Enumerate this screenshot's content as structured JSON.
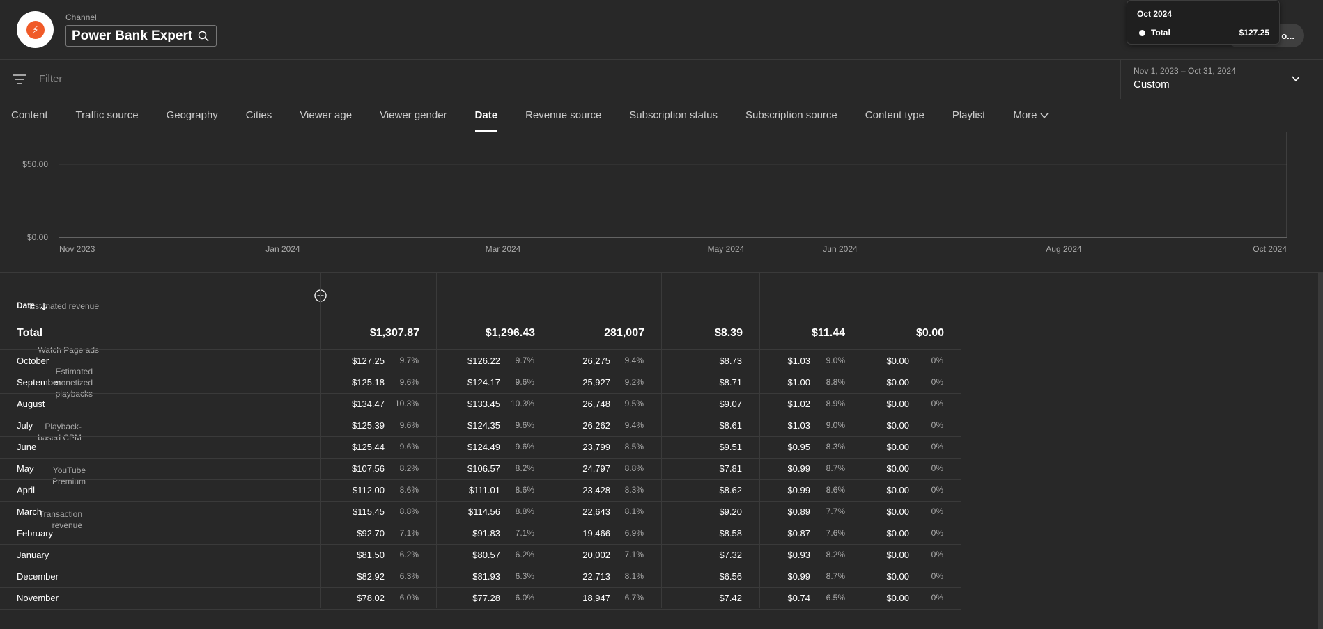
{
  "header": {
    "channel_label": "Channel",
    "channel_name": "Power Bank Expert",
    "button_label": "o..."
  },
  "tooltip": {
    "title": "Oct 2024",
    "series_label": "Total",
    "value": "$127.25"
  },
  "filter": {
    "placeholder": "Filter"
  },
  "date_picker": {
    "range": "Nov 1, 2023 – Oct 31, 2024",
    "value": "Custom"
  },
  "tabs": [
    {
      "label": "Content"
    },
    {
      "label": "Traffic source"
    },
    {
      "label": "Geography"
    },
    {
      "label": "Cities"
    },
    {
      "label": "Viewer age"
    },
    {
      "label": "Viewer gender"
    },
    {
      "label": "Date"
    },
    {
      "label": "Revenue source"
    },
    {
      "label": "Subscription status"
    },
    {
      "label": "Subscription source"
    },
    {
      "label": "Content type"
    },
    {
      "label": "Playlist"
    },
    {
      "label": "More"
    }
  ],
  "active_tab": "Date",
  "chart_data": {
    "type": "line",
    "y_ticks": [
      "$50.00",
      "$0.00"
    ],
    "x_ticks": [
      "Nov 2023",
      "Jan 2024",
      "Mar 2024",
      "May 2024",
      "Jun 2024",
      "Aug 2024",
      "Oct 2024"
    ],
    "ylim": [
      0,
      50
    ]
  },
  "table": {
    "date_header": "Date",
    "columns": [
      {
        "l1": "",
        "l2": "",
        "l3": "Estimated revenue"
      },
      {
        "l1": "",
        "l2": "",
        "l3": "Watch Page ads"
      },
      {
        "l1": "Estimated",
        "l2": "monetized",
        "l3": "playbacks"
      },
      {
        "l1": "",
        "l2": "Playback-",
        "l3": "based CPM"
      },
      {
        "l1": "",
        "l2": "YouTube",
        "l3": "Premium"
      },
      {
        "l1": "",
        "l2": "Transaction",
        "l3": "revenue"
      }
    ],
    "total": {
      "label": "Total",
      "values": [
        "$1,307.87",
        "$1,296.43",
        "281,007",
        "$8.39",
        "$11.44",
        "$0.00"
      ]
    },
    "rows": [
      {
        "label": "October",
        "c": [
          [
            "$127.25",
            "9.7%"
          ],
          [
            "$126.22",
            "9.7%"
          ],
          [
            "26,275",
            "9.4%"
          ],
          [
            "$8.73",
            ""
          ],
          [
            "$1.03",
            "9.0%"
          ],
          [
            "$0.00",
            "0%"
          ]
        ]
      },
      {
        "label": "September",
        "c": [
          [
            "$125.18",
            "9.6%"
          ],
          [
            "$124.17",
            "9.6%"
          ],
          [
            "25,927",
            "9.2%"
          ],
          [
            "$8.71",
            ""
          ],
          [
            "$1.00",
            "8.8%"
          ],
          [
            "$0.00",
            "0%"
          ]
        ]
      },
      {
        "label": "August",
        "c": [
          [
            "$134.47",
            "10.3%"
          ],
          [
            "$133.45",
            "10.3%"
          ],
          [
            "26,748",
            "9.5%"
          ],
          [
            "$9.07",
            ""
          ],
          [
            "$1.02",
            "8.9%"
          ],
          [
            "$0.00",
            "0%"
          ]
        ]
      },
      {
        "label": "July",
        "c": [
          [
            "$125.39",
            "9.6%"
          ],
          [
            "$124.35",
            "9.6%"
          ],
          [
            "26,262",
            "9.4%"
          ],
          [
            "$8.61",
            ""
          ],
          [
            "$1.03",
            "9.0%"
          ],
          [
            "$0.00",
            "0%"
          ]
        ]
      },
      {
        "label": "June",
        "c": [
          [
            "$125.44",
            "9.6%"
          ],
          [
            "$124.49",
            "9.6%"
          ],
          [
            "23,799",
            "8.5%"
          ],
          [
            "$9.51",
            ""
          ],
          [
            "$0.95",
            "8.3%"
          ],
          [
            "$0.00",
            "0%"
          ]
        ]
      },
      {
        "label": "May",
        "c": [
          [
            "$107.56",
            "8.2%"
          ],
          [
            "$106.57",
            "8.2%"
          ],
          [
            "24,797",
            "8.8%"
          ],
          [
            "$7.81",
            ""
          ],
          [
            "$0.99",
            "8.7%"
          ],
          [
            "$0.00",
            "0%"
          ]
        ]
      },
      {
        "label": "April",
        "c": [
          [
            "$112.00",
            "8.6%"
          ],
          [
            "$111.01",
            "8.6%"
          ],
          [
            "23,428",
            "8.3%"
          ],
          [
            "$8.62",
            ""
          ],
          [
            "$0.99",
            "8.6%"
          ],
          [
            "$0.00",
            "0%"
          ]
        ]
      },
      {
        "label": "March",
        "c": [
          [
            "$115.45",
            "8.8%"
          ],
          [
            "$114.56",
            "8.8%"
          ],
          [
            "22,643",
            "8.1%"
          ],
          [
            "$9.20",
            ""
          ],
          [
            "$0.89",
            "7.7%"
          ],
          [
            "$0.00",
            "0%"
          ]
        ]
      },
      {
        "label": "February",
        "c": [
          [
            "$92.70",
            "7.1%"
          ],
          [
            "$91.83",
            "7.1%"
          ],
          [
            "19,466",
            "6.9%"
          ],
          [
            "$8.58",
            ""
          ],
          [
            "$0.87",
            "7.6%"
          ],
          [
            "$0.00",
            "0%"
          ]
        ]
      },
      {
        "label": "January",
        "c": [
          [
            "$81.50",
            "6.2%"
          ],
          [
            "$80.57",
            "6.2%"
          ],
          [
            "20,002",
            "7.1%"
          ],
          [
            "$7.32",
            ""
          ],
          [
            "$0.93",
            "8.2%"
          ],
          [
            "$0.00",
            "0%"
          ]
        ]
      },
      {
        "label": "December",
        "c": [
          [
            "$82.92",
            "6.3%"
          ],
          [
            "$81.93",
            "6.3%"
          ],
          [
            "22,713",
            "8.1%"
          ],
          [
            "$6.56",
            ""
          ],
          [
            "$0.99",
            "8.7%"
          ],
          [
            "$0.00",
            "0%"
          ]
        ]
      },
      {
        "label": "November",
        "c": [
          [
            "$78.02",
            "6.0%"
          ],
          [
            "$77.28",
            "6.0%"
          ],
          [
            "18,947",
            "6.7%"
          ],
          [
            "$7.42",
            ""
          ],
          [
            "$0.74",
            "6.5%"
          ],
          [
            "$0.00",
            "0%"
          ]
        ]
      }
    ]
  }
}
